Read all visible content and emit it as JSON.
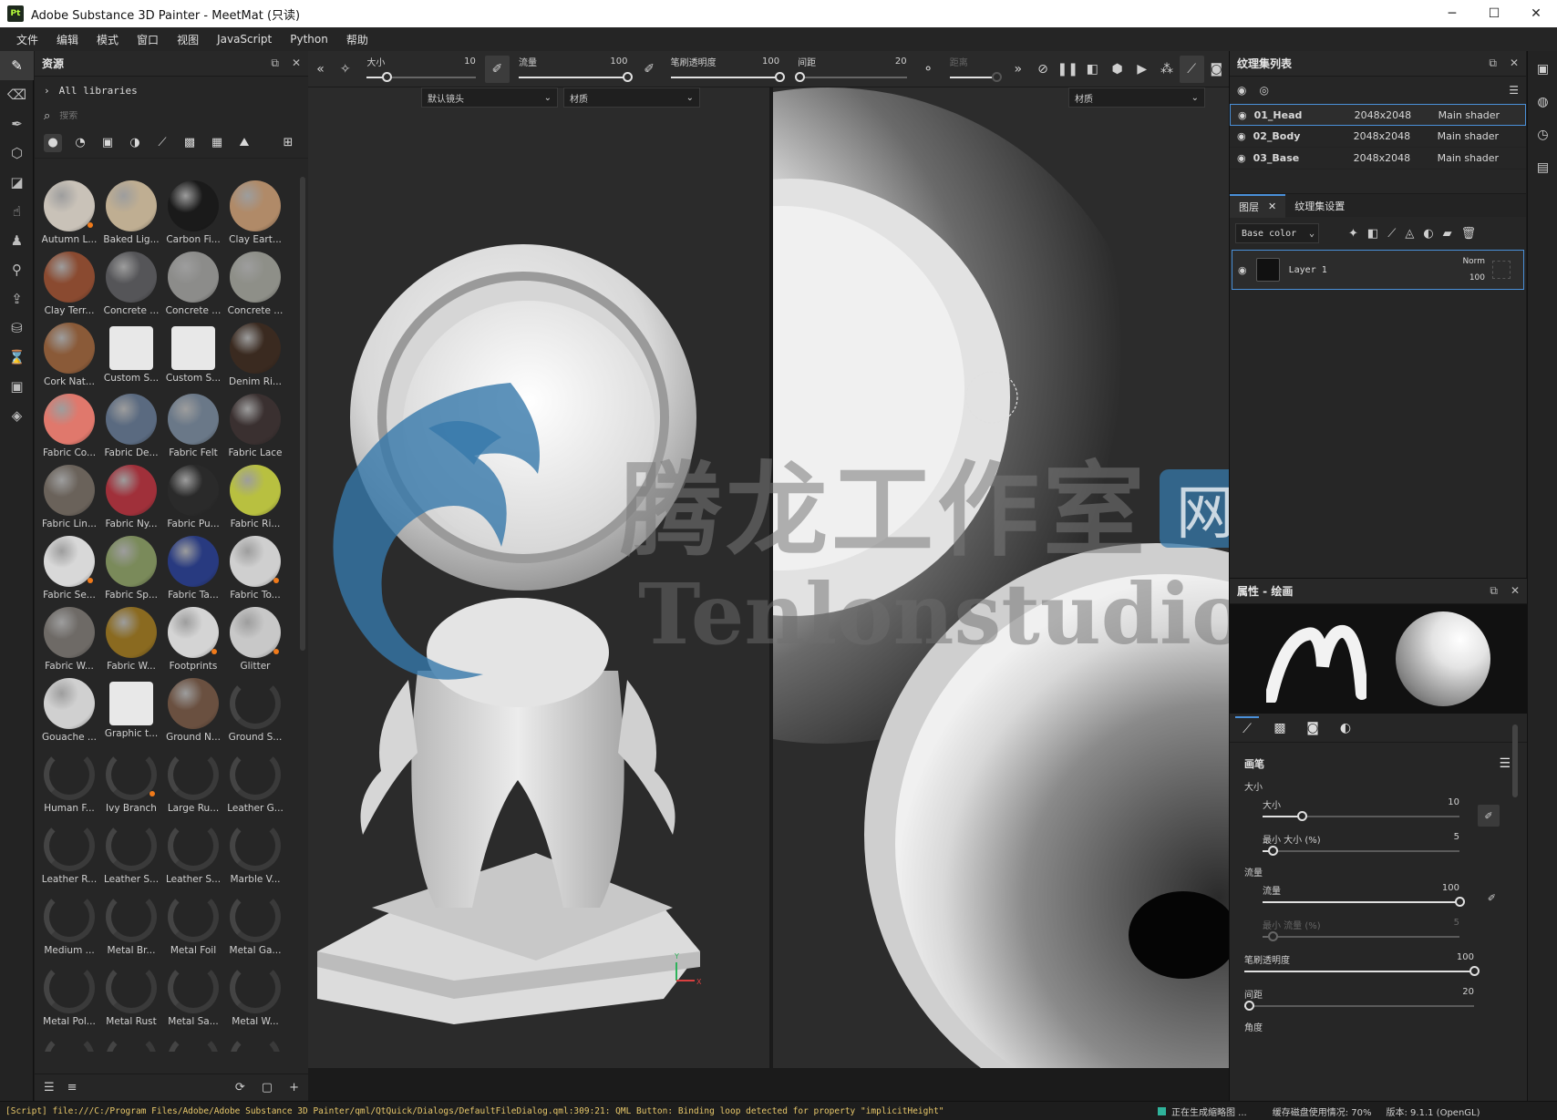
{
  "window": {
    "title": "Adobe Substance 3D Painter - MeetMat (只读)",
    "app_icon_text": "Pt",
    "minimize": "─",
    "maximize": "☐",
    "close": "✕"
  },
  "menu": [
    "文件",
    "编辑",
    "模式",
    "窗口",
    "视图",
    "JavaScript",
    "Python",
    "帮助"
  ],
  "tools": [
    "paint-brush",
    "eraser",
    "projection",
    "geometry-mask",
    "polygon-fill",
    "smudge",
    "clone",
    "color-picker",
    "export",
    "bake",
    "history",
    "display",
    "texture-sets"
  ],
  "assets": {
    "title": "资源",
    "library": "All libraries",
    "search_placeholder": "搜索",
    "items": [
      {
        "label": "Autumn L...",
        "color": "#c9c2b8",
        "dot": true
      },
      {
        "label": "Baked Lig...",
        "color": "#bfae92"
      },
      {
        "label": "Carbon Fi...",
        "color": "#1a1a1a"
      },
      {
        "label": "Clay Eart...",
        "color": "#b08a68"
      },
      {
        "label": "Clay Terr...",
        "color": "#8a4a30"
      },
      {
        "label": "Concrete ...",
        "color": "#555558"
      },
      {
        "label": "Concrete ...",
        "color": "#8c8c8a"
      },
      {
        "label": "Concrete ...",
        "color": "#8e8f88"
      },
      {
        "label": "Cork Nat...",
        "color": "#8a5a38"
      },
      {
        "label": "Custom S...",
        "tile": true
      },
      {
        "label": "Custom S...",
        "tile": true
      },
      {
        "label": "Denim Ri...",
        "color": "#3a2a20"
      },
      {
        "label": "Fabric Co...",
        "color": "#e0786c"
      },
      {
        "label": "Fabric De...",
        "color": "#5a6a80"
      },
      {
        "label": "Fabric Felt",
        "color": "#6a7888"
      },
      {
        "label": "Fabric Lace",
        "color": "#3a3030"
      },
      {
        "label": "Fabric Lin...",
        "color": "#6a625a"
      },
      {
        "label": "Fabric Ny...",
        "color": "#a0303a"
      },
      {
        "label": "Fabric Pu...",
        "color": "#2a2a2a"
      },
      {
        "label": "Fabric Ri...",
        "color": "#b8c040"
      },
      {
        "label": "Fabric Se...",
        "color": "#d8d8d8",
        "dot": true
      },
      {
        "label": "Fabric Sp...",
        "color": "#7a8a5a"
      },
      {
        "label": "Fabric Ta...",
        "color": "#283a80"
      },
      {
        "label": "Fabric To...",
        "color": "#cfcfcf",
        "dot": true
      },
      {
        "label": "Fabric W...",
        "color": "#6e6a66"
      },
      {
        "label": "Fabric W...",
        "color": "#8a6a20"
      },
      {
        "label": "Footprints",
        "color": "#d4d4d4",
        "dot": true
      },
      {
        "label": "Glitter",
        "color": "#c8c8c8",
        "dot": true
      },
      {
        "label": "Gouache ...",
        "color": "#d0d0d0"
      },
      {
        "label": "Graphic t...",
        "tile": true
      },
      {
        "label": "Ground N...",
        "color": "#6a5040"
      },
      {
        "label": "Ground S...",
        "loading": true
      },
      {
        "label": "Human F...",
        "loading": true
      },
      {
        "label": "Ivy Branch",
        "loading": true,
        "dot": true
      },
      {
        "label": "Large Ru...",
        "loading": true
      },
      {
        "label": "Leather G...",
        "loading": true
      },
      {
        "label": "Leather R...",
        "loading": true
      },
      {
        "label": "Leather S...",
        "loading": true
      },
      {
        "label": "Leather S...",
        "loading": true
      },
      {
        "label": "Marble V...",
        "loading": true
      },
      {
        "label": "Medium ...",
        "loading": true
      },
      {
        "label": "Metal Br...",
        "loading": true
      },
      {
        "label": "Metal Foil",
        "loading": true
      },
      {
        "label": "Metal Ga...",
        "loading": true
      },
      {
        "label": "Metal Pol...",
        "loading": true
      },
      {
        "label": "Metal Rust",
        "loading": true
      },
      {
        "label": "Metal Sa...",
        "loading": true
      },
      {
        "label": "Metal W...",
        "loading": true
      },
      {
        "label": "",
        "loading": true
      },
      {
        "label": "",
        "loading": true
      },
      {
        "label": "",
        "loading": true
      },
      {
        "label": "",
        "loading": true
      }
    ]
  },
  "toolbar": {
    "size": {
      "label": "大小",
      "value": "10",
      "fraction": 0.18
    },
    "flow": {
      "label": "流量",
      "value": "100",
      "fraction": 1.0
    },
    "opacity": {
      "label": "笔刷透明度",
      "value": "100",
      "fraction": 1.0
    },
    "spacing": {
      "label": "间距",
      "value": "20",
      "fraction": 0.02
    },
    "distance": {
      "label": "距离",
      "fraction": 1.0
    }
  },
  "viewport": {
    "camera": "默认镜头",
    "channel_left": "材质",
    "channel_right": "材质",
    "axis_y": "Y",
    "axis_x": "X"
  },
  "watermark": {
    "cn": "腾龙工作室",
    "badge": "网站",
    "en": "Tenlonstudio.com"
  },
  "texture_sets": {
    "title": "纹理集列表",
    "rows": [
      {
        "name": "01_Head",
        "res": "2048x2048",
        "shader": "Main shader",
        "selected": true
      },
      {
        "name": "02_Body",
        "res": "2048x2048",
        "shader": "Main shader"
      },
      {
        "name": "03_Base",
        "res": "2048x2048",
        "shader": "Main shader"
      }
    ]
  },
  "layers": {
    "tab_layers": "图层",
    "tab_settings": "纹理集设置",
    "channel": "Base color",
    "layer_name": "Layer 1",
    "blend": "Norm",
    "opacity": "100"
  },
  "properties": {
    "title": "属性 - 绘画",
    "section": "画笔",
    "size_group": "大小",
    "size": {
      "label": "大小",
      "value": "10",
      "fraction": 0.2
    },
    "min_size": {
      "label": "最小 大小 (%)",
      "value": "5",
      "fraction": 0.05
    },
    "flow_group": "流量",
    "flow": {
      "label": "流量",
      "value": "100",
      "fraction": 1.0
    },
    "min_flow": {
      "label": "最小 流量 (%)",
      "value": "5",
      "fraction": 0.05
    },
    "opacity": {
      "label": "笔刷透明度",
      "value": "100",
      "fraction": 1.0
    },
    "spacing": {
      "label": "间距",
      "value": "20",
      "fraction": 0.02
    },
    "angle": {
      "label": "角度"
    }
  },
  "status": {
    "log": "[Script] file:///C:/Program Files/Adobe/Adobe Substance 3D Painter/qml/QtQuick/Dialogs/DefaultFileDialog.qml:309:21: QML Button: Binding loop detected for property \"implicitHeight\"",
    "generating": "正在生成缩略图 ...",
    "disk": "缓存磁盘使用情况:  70%",
    "version": "版本: 9.1.1 (OpenGL)"
  }
}
